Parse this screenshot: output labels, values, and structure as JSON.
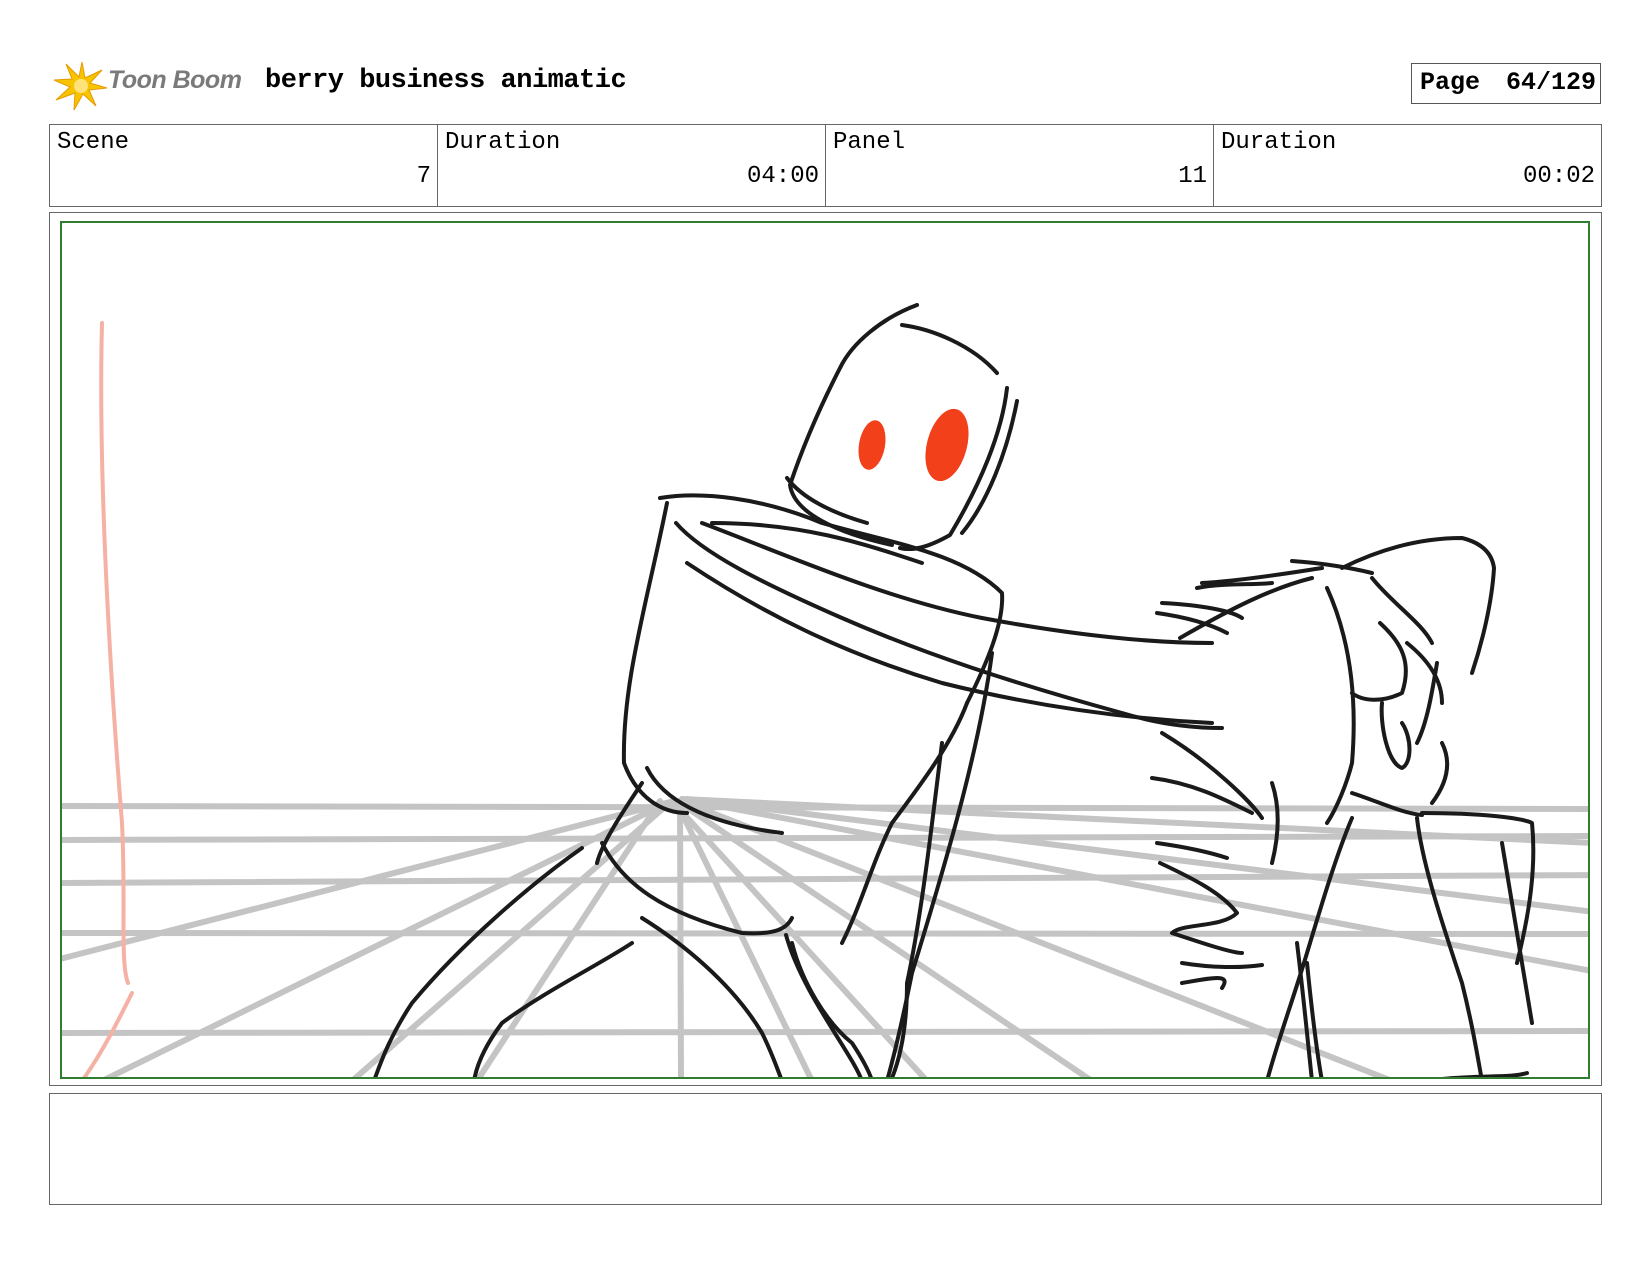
{
  "header": {
    "logo_text": "Toon Boom",
    "title": "berry business animatic",
    "page_label": "Page",
    "page_value": "64/129"
  },
  "info": [
    {
      "label": "Scene",
      "value": "7"
    },
    {
      "label": "Duration",
      "value": "04:00"
    },
    {
      "label": "Panel",
      "value": "11"
    },
    {
      "label": "Duration",
      "value": "00:02"
    }
  ],
  "colors": {
    "frame_border": "#2f7d2f",
    "eye_red": "#f2411a",
    "guide_gray": "#c4c4c4",
    "logo_yellow": "#f7c400"
  },
  "notes_text": ""
}
